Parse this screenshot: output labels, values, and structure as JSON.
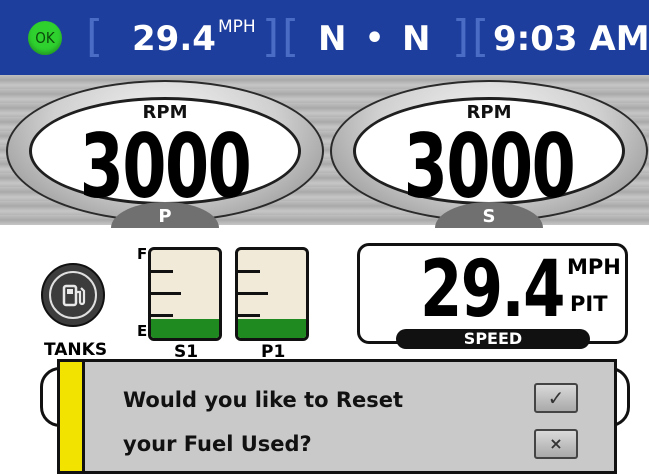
{
  "status_bar": {
    "ok_label": "OK",
    "speed": "29.4",
    "speed_unit": "MPH",
    "heading_left": "N",
    "heading_sep": "•",
    "heading_right": "N",
    "time": "9:03 AM"
  },
  "gauges": [
    {
      "label": "RPM",
      "value": "3000",
      "side": "P"
    },
    {
      "label": "RPM",
      "value": "3000",
      "side": "S"
    }
  ],
  "fuel": {
    "tanks_label": "TANKS",
    "full_marker": "F",
    "empty_marker": "E",
    "tanks": [
      {
        "label": "S1",
        "level_fraction": 0.22
      },
      {
        "label": "P1",
        "level_fraction": 0.22
      }
    ],
    "icon": "fuel-pump-icon"
  },
  "speed_panel": {
    "value": "29.4",
    "unit_top": "MPH",
    "unit_bottom": "PIT",
    "tab_label": "SPEED"
  },
  "dialog": {
    "line1": "Would you like to Reset",
    "line2": "your Fuel Used?",
    "confirm_symbol": "✓",
    "cancel_symbol": "×"
  },
  "colors": {
    "status_bar": "#1d3e9c",
    "ok_badge": "#2fd12f",
    "fuel_fill": "#1f8a1f",
    "dialog_stripe": "#f2e300"
  }
}
